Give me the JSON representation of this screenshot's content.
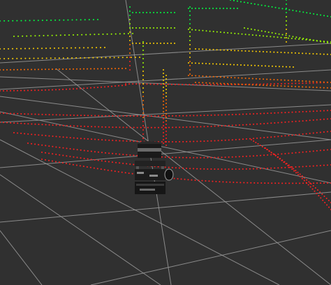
{
  "viewport": {
    "background_color": "#303030",
    "grid_color": "#9a9a9a"
  },
  "robot": {
    "type": "mobile-robot-with-spinning-lidar",
    "body_color": "#1b1b1b",
    "highlight_color": "#8a8a8a"
  },
  "point_cloud": {
    "colormap": [
      "#ff2020",
      "#ff6a00",
      "#ffd000",
      "#9cff00",
      "#00ff40"
    ],
    "color_meaning": "height"
  }
}
